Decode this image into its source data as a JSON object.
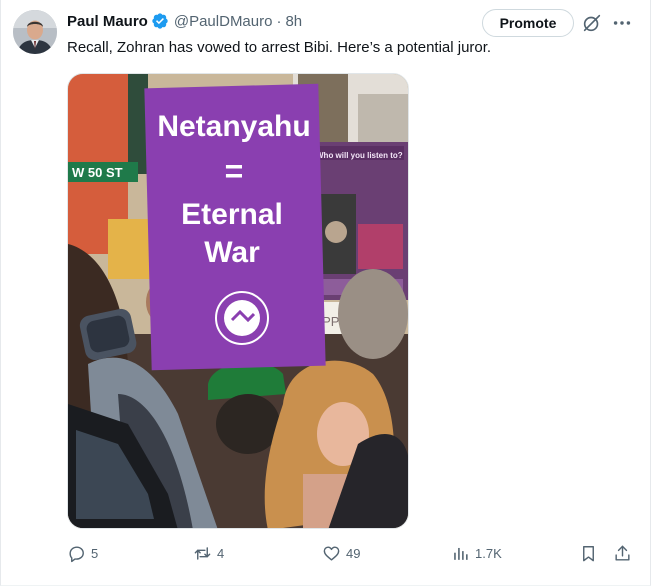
{
  "tweet": {
    "author_name": "Paul Mauro",
    "handle": "@PaulDMauro",
    "separator": "·",
    "time": "8h",
    "text": "Recall, Zohran has vowed to arrest Bibi. Here’s a potential juror.",
    "promote_label": "Promote"
  },
  "media": {
    "sign_main": [
      "Netanyahu",
      "=",
      "Eternal",
      "War"
    ],
    "street_sign": "W 50 ST",
    "sign_right_heading": "Who will you listen to?",
    "background_sign_fragment": "OPPRES"
  },
  "actions": {
    "replies": "5",
    "reposts": "4",
    "likes": "49",
    "views": "1.7K"
  },
  "colors": {
    "verified": "#1d9bf0",
    "text_secondary": "#536471",
    "sign_purple": "#8a3fb0"
  },
  "icons": [
    "verified-badge-icon",
    "grok-icon",
    "more-icon",
    "reply-icon",
    "repost-icon",
    "like-icon",
    "views-icon",
    "bookmark-icon",
    "share-icon"
  ]
}
